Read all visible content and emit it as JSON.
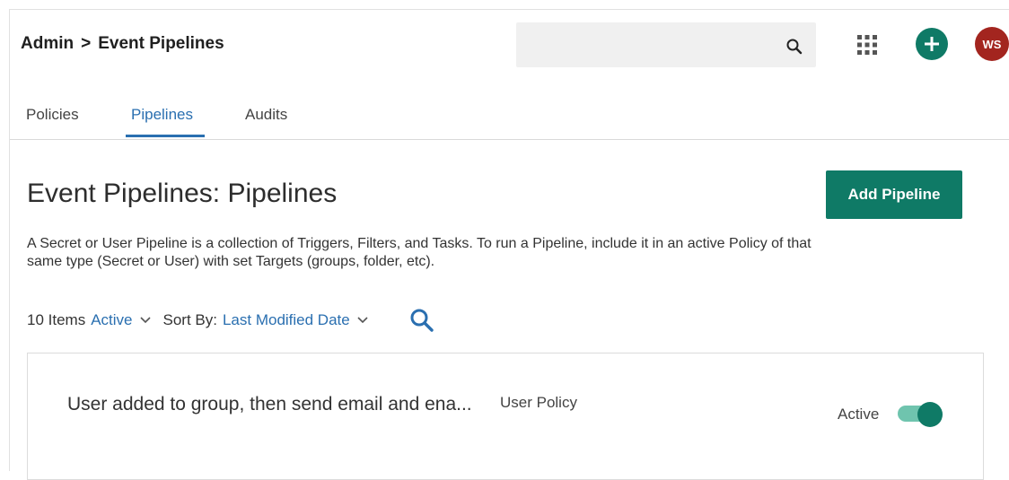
{
  "header": {
    "breadcrumb": [
      "Admin",
      "Event Pipelines"
    ],
    "breadcrumb_separator": ">",
    "search": {
      "placeholder": ""
    },
    "avatar_initials": "WS",
    "icons": [
      "search-icon",
      "apps-grid-icon",
      "plus-icon"
    ]
  },
  "tabs": [
    {
      "label": "Policies",
      "active": false
    },
    {
      "label": "Pipelines",
      "active": true
    },
    {
      "label": "Audits",
      "active": false
    }
  ],
  "main": {
    "title": "Event Pipelines: Pipelines",
    "add_button": "Add Pipeline",
    "description": "A Secret or User Pipeline is a collection of Triggers, Filters, and Tasks. To run a Pipeline, include it in an active Policy of that same type (Secret or User) with set Targets (groups, folder, etc).",
    "filters": {
      "count": "10 Items",
      "status": "Active",
      "sort_label": "Sort By:",
      "sort_value": "Last Modified Date"
    },
    "pipelines": [
      {
        "name": "User added to group, then send email and ena...",
        "type": "User Policy",
        "status": "Active",
        "enabled": true
      }
    ]
  },
  "colors": {
    "accent": "#0f7a66",
    "link": "#2a6fb0",
    "avatar": "#a3251f",
    "search_bg": "#f0f0f0"
  }
}
